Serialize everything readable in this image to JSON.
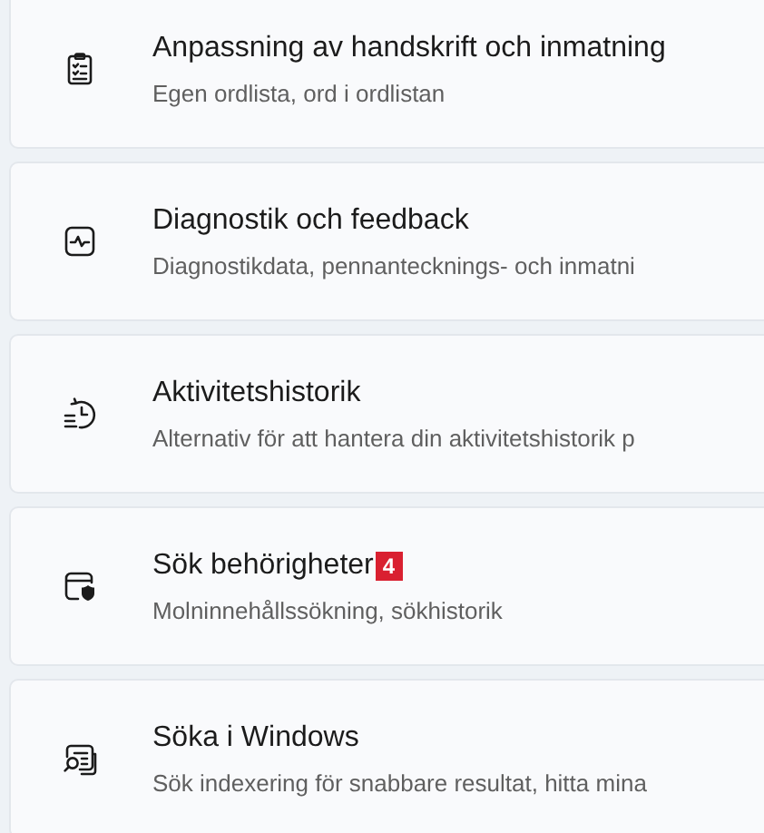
{
  "items": [
    {
      "title": "Anpassning av handskrift och inmatning",
      "subtitle": "Egen ordlista, ord i ordlistan"
    },
    {
      "title": "Diagnostik och feedback",
      "subtitle": "Diagnostikdata, pennantecknings- och inmatni"
    },
    {
      "title": "Aktivitetshistorik",
      "subtitle": "Alternativ för att hantera din aktivitetshistorik p"
    },
    {
      "title": "Sök behörigheter",
      "badge": "4",
      "subtitle": "Molninnehållssökning, sökhistorik"
    },
    {
      "title": "Söka i Windows",
      "subtitle": "Sök indexering för snabbare resultat, hitta mina"
    }
  ]
}
